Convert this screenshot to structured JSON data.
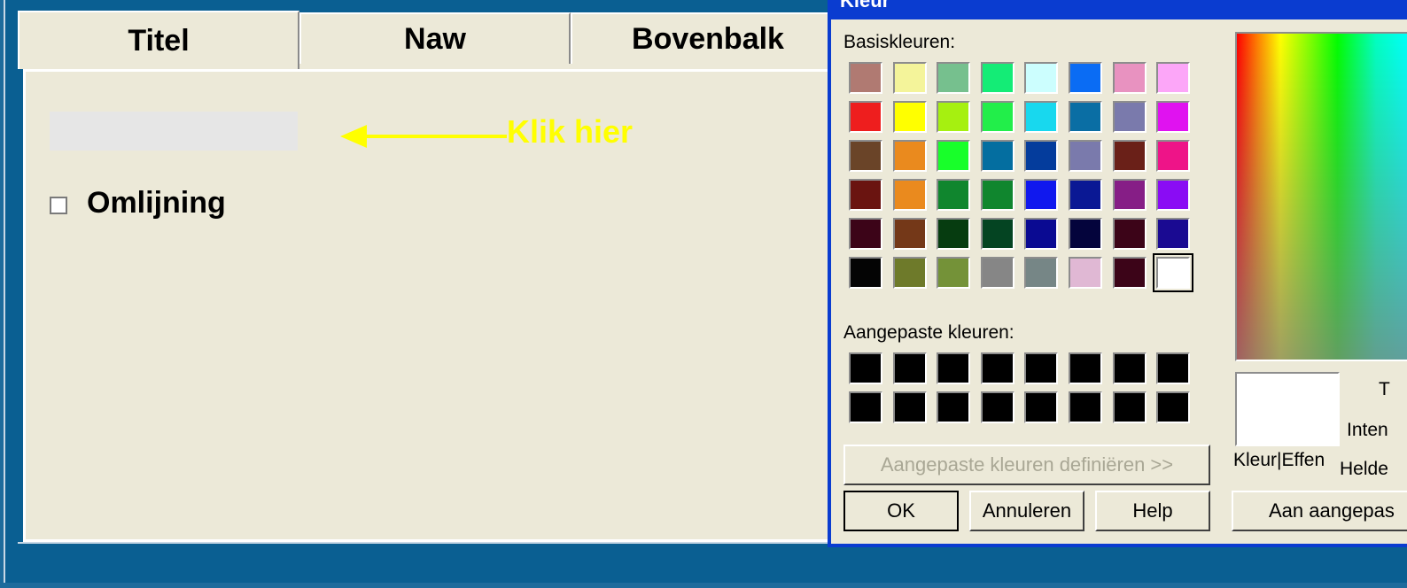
{
  "tabs": {
    "titel": "Titel",
    "naw": "Naw",
    "bovenbalk": "Bovenbalk"
  },
  "panel": {
    "hint": "Klik hier",
    "checkbox_label": "Omlijning"
  },
  "dialog": {
    "title": "Kleur",
    "basic_colors_label": "Basiskleuren:",
    "custom_colors_label": "Aangepaste kleuren:",
    "define_button": "Aangepaste kleuren definiëren >>",
    "ok_button": "OK",
    "cancel_button": "Annuleren",
    "help_button": "Help",
    "preview_label": "Kleur|Effen",
    "hue_label": "T",
    "sat_label": "Inten",
    "lum_label": "Helde",
    "add_button": "Aan aangepas",
    "basic_colors": [
      "#b07a72",
      "#f4f49a",
      "#76c08e",
      "#14ec76",
      "#ccfefe",
      "#0a6cf4",
      "#e892c0",
      "#fca6f8",
      "#ee1e1e",
      "#ffff00",
      "#a6f010",
      "#22ee4a",
      "#18d8ee",
      "#0a6ea4",
      "#7a7aac",
      "#e012f0",
      "#6a4428",
      "#ea8a1e",
      "#18ff2a",
      "#046ea0",
      "#043c9c",
      "#7a7aac",
      "#6a2018",
      "#ee1488",
      "#6a1410",
      "#ea8a1e",
      "#10862e",
      "#10862e",
      "#1018ee",
      "#0a1894",
      "#861e86",
      "#8a0cf4",
      "#3c0418",
      "#743818",
      "#063c10",
      "#044422",
      "#0a0a92",
      "#04043c",
      "#3c0418",
      "#1a0a92",
      "#040404",
      "#6e7a2a",
      "#749238",
      "#868686",
      "#768686",
      "#e0b8d4",
      "#3c0418",
      "#ffffff"
    ],
    "custom_colors": [
      "#000000",
      "#000000",
      "#000000",
      "#000000",
      "#000000",
      "#000000",
      "#000000",
      "#000000",
      "#000000",
      "#000000",
      "#000000",
      "#000000",
      "#000000",
      "#000000",
      "#000000",
      "#000000"
    ],
    "selected_basic_index": 47
  }
}
